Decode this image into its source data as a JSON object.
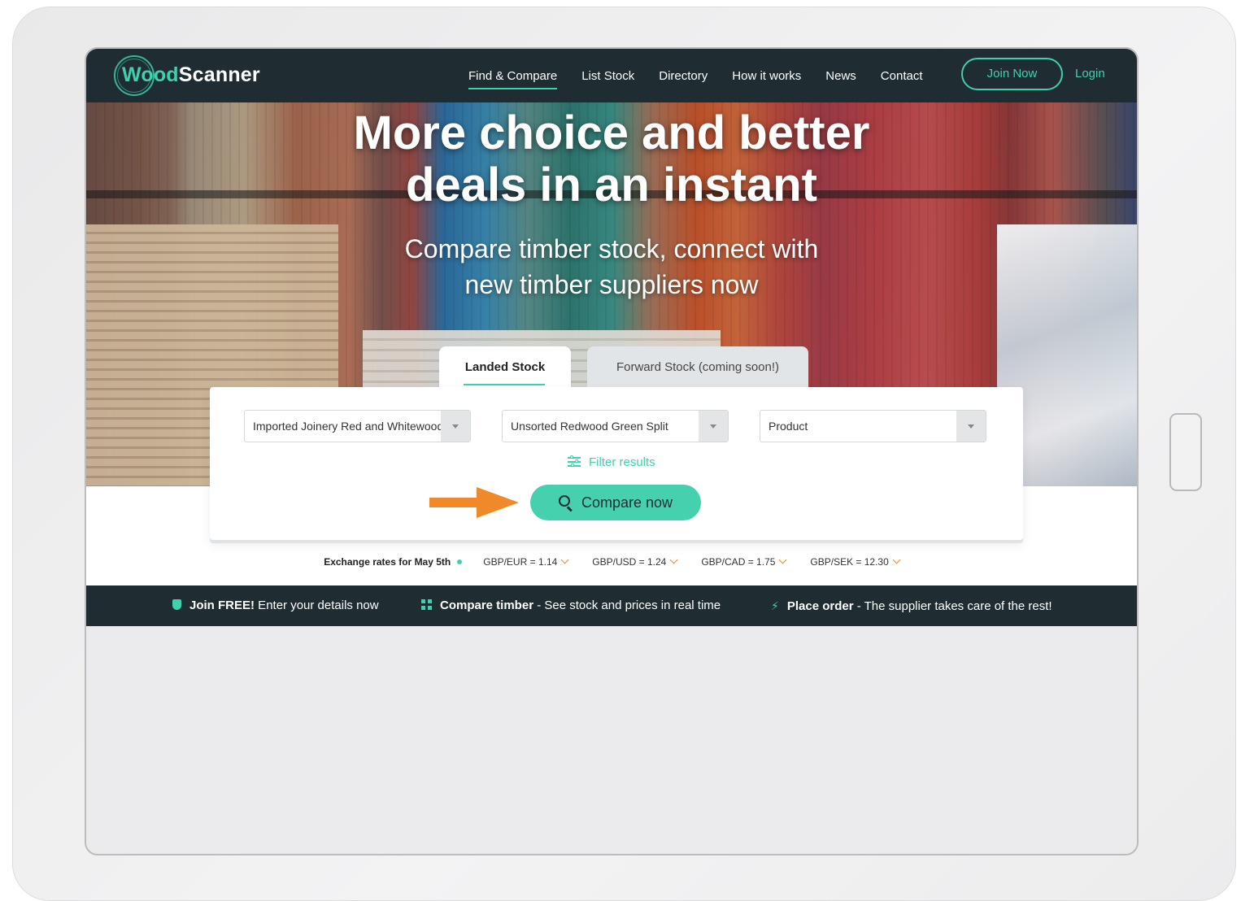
{
  "brand": {
    "logo_part1": "Wood",
    "logo_part2": "Scanner",
    "accent_color": "#3fd0ad",
    "nav_color": "#1f2d32"
  },
  "nav": {
    "links": [
      "Find & Compare",
      "List Stock",
      "Directory",
      "How it works",
      "News",
      "Contact"
    ],
    "active": "Find & Compare",
    "join_label": "Join Now",
    "login_label": "Login"
  },
  "hero": {
    "title_line1": "More choice and better",
    "title_line2": "deals in an instant",
    "subtitle_line1": "Compare timber stock, connect with",
    "subtitle_line2": "new timber suppliers now"
  },
  "tabs": {
    "landed": "Landed Stock",
    "forward": "Forward Stock (coming soon!)"
  },
  "search": {
    "select1": "Imported Joinery Red and Whitewood",
    "select2": "Unsorted Redwood Green Split",
    "select3": "Product",
    "filter_label": "Filter results",
    "compare_label": "Compare now"
  },
  "rates": {
    "title": "Exchange rates for May 5th",
    "items": [
      "GBP/EUR = 1.14",
      "GBP/USD = 1.24",
      "GBP/CAD = 1.75",
      "GBP/SEK = 12.30"
    ],
    "trend": "down",
    "trend_color": "#e9863d"
  },
  "strip": {
    "item1_bold": "Join FREE!",
    "item1_text": " Enter your details now",
    "item2_bold": "Compare timber",
    "item2_text": " - See stock and prices in real time",
    "item3_bold": "Place order",
    "item3_text": " - The supplier takes care of the rest!"
  },
  "annotation": {
    "arrow_color": "#f0892a",
    "arrow_icon": "arrow-right-icon"
  }
}
